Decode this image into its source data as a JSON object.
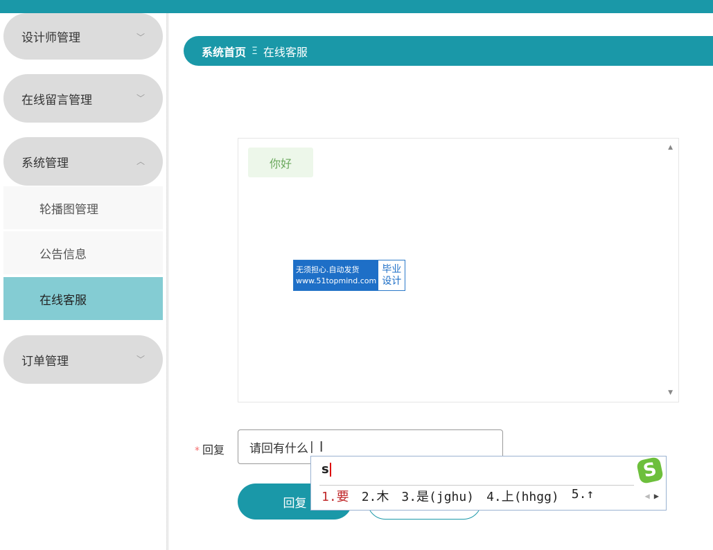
{
  "sidebar": {
    "menus": [
      {
        "label": "设计师管理",
        "chevron": "chevron-down-icon"
      },
      {
        "label": "在线留言管理",
        "chevron": "chevron-down-icon"
      },
      {
        "label": "系统管理",
        "chevron": "chevron-up-icon"
      },
      {
        "label": "订单管理",
        "chevron": "chevron-down-icon"
      }
    ],
    "submenus": [
      {
        "label": "轮播图管理"
      },
      {
        "label": "公告信息"
      },
      {
        "label": "在线客服",
        "active": true
      }
    ]
  },
  "breadcrumb": {
    "home": "系统首页",
    "separator": "Ξ",
    "current": "在线客服"
  },
  "chat": {
    "messages": [
      {
        "text": "你好"
      }
    ]
  },
  "watermark": {
    "left_line1": "无须担心.自动发货",
    "left_line2": "www.51topmind.com",
    "right_line1": "毕业",
    "right_line2": "设计"
  },
  "reply": {
    "required_mark": "*",
    "label": "回复",
    "value": "请回有什么"
  },
  "buttons": {
    "reply": "回复"
  },
  "ime": {
    "pinyin": "s",
    "candidates": [
      "1.要",
      "2.木",
      "3.是(jghu)",
      "4.上(hhgg)",
      "5.↑"
    ],
    "logo": "S"
  },
  "colors": {
    "accent": "#1a98a8",
    "active_menu": "#84ccd3",
    "bubble_bg": "#edf7ea"
  }
}
